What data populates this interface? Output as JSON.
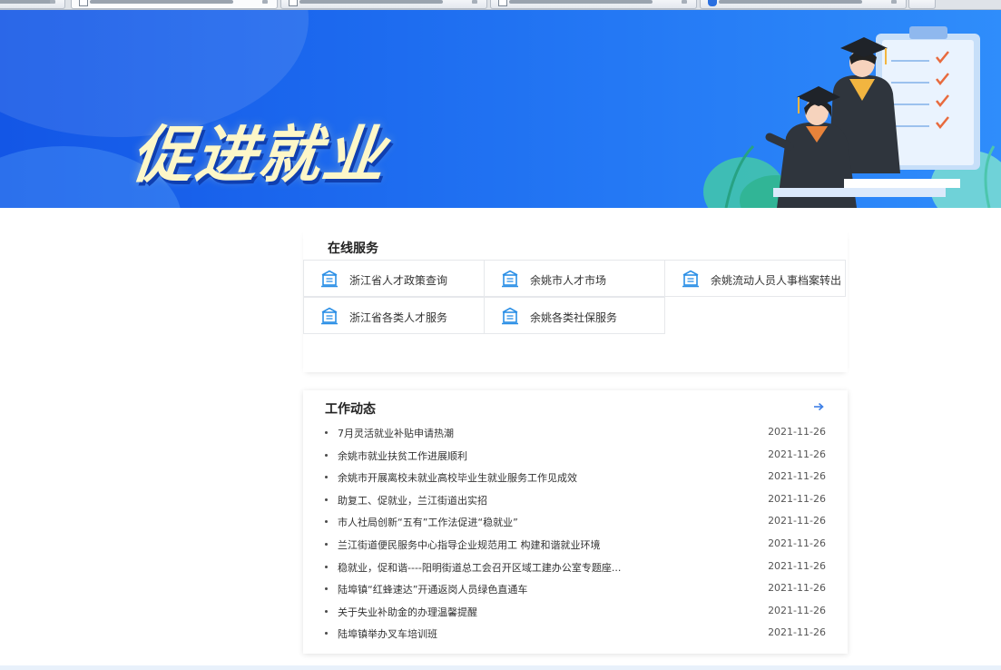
{
  "banner": {
    "title": "促进就业"
  },
  "services": {
    "title": "在线服务",
    "items": [
      {
        "label": "浙江省人才政策查询"
      },
      {
        "label": "余姚市人才市场"
      },
      {
        "label": "余姚流动人员人事档案转出"
      },
      {
        "label": "浙江省各类人才服务"
      },
      {
        "label": "余姚各类社保服务"
      }
    ]
  },
  "news": {
    "title": "工作动态",
    "items": [
      {
        "title": "7月灵活就业补贴申请热潮",
        "date": "2021-11-26"
      },
      {
        "title": "余姚市就业扶贫工作进展顺利",
        "date": "2021-11-26"
      },
      {
        "title": "余姚市开展离校未就业高校毕业生就业服务工作见成效",
        "date": "2021-11-26"
      },
      {
        "title": "助复工、促就业，兰江街道出实招",
        "date": "2021-11-26"
      },
      {
        "title": "市人社局创新“五有”工作法促进“稳就业”",
        "date": "2021-11-26"
      },
      {
        "title": "兰江街道便民服务中心指导企业规范用工 构建和谐就业环境",
        "date": "2021-11-26"
      },
      {
        "title": "稳就业，促和谐----阳明街道总工会召开区域工建办公室专题座...",
        "date": "2021-11-26"
      },
      {
        "title": "陆埠镇“红蜂速达”开通返岗人员绿色直通车",
        "date": "2021-11-26"
      },
      {
        "title": "关于失业补助金的办理温馨提醒",
        "date": "2021-11-26"
      },
      {
        "title": "陆埠镇举办叉车培训班",
        "date": "2021-11-26"
      }
    ]
  },
  "colors": {
    "banner_blue": "#1f6ff1",
    "title_cream": "#fdf7c8",
    "icon_blue": "#2b8fe6",
    "arrow_blue": "#3d7fe6"
  },
  "icons": {
    "service": "building-icon",
    "more": "arrow-right-icon"
  }
}
